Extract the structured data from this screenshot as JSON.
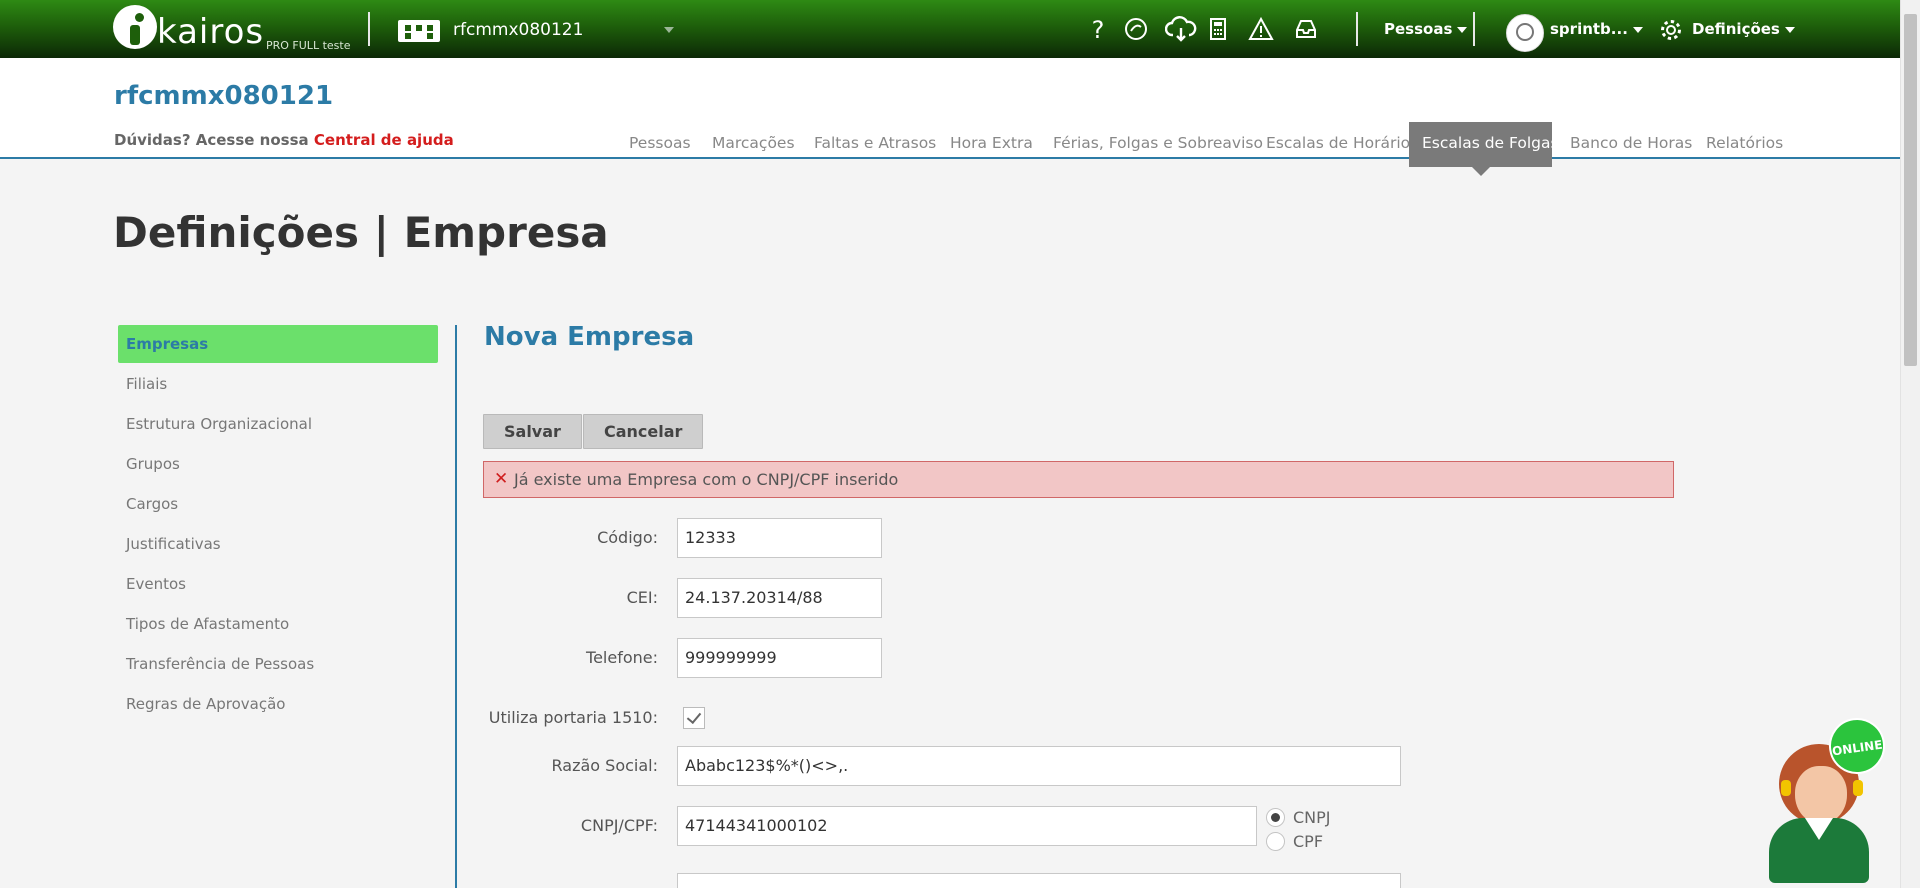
{
  "topbar": {
    "logo_word": "kairos",
    "logo_sub": "PRO FULL teste",
    "tenant_name": "rfcmmx080121",
    "menu_pessoas": "Pessoas",
    "user_name": "sprintb...",
    "menu_definicoes": "Definições",
    "icons": [
      "question-icon",
      "support-chat-icon",
      "cloud-download-icon",
      "calculator-icon",
      "warning-icon",
      "inbox-icon",
      "gear-icon"
    ]
  },
  "header": {
    "site_title": "rfcmmx080121",
    "help_prefix": "Dúvidas? Acesse nossa",
    "help_link": "Central de ajuda"
  },
  "nav": [
    {
      "label": "Pessoas"
    },
    {
      "label": "Marcações"
    },
    {
      "label": "Faltas e Atrasos"
    },
    {
      "label": "Hora Extra"
    },
    {
      "label": "Férias, Folgas e Sobreaviso"
    },
    {
      "label": "Escalas de Horário"
    },
    {
      "label": "Escalas de Folgas",
      "active": true
    },
    {
      "label": "Banco de Horas"
    },
    {
      "label": "Relatórios"
    }
  ],
  "page_title": "Definições | Empresa",
  "sidebar": [
    {
      "label": "Empresas",
      "active": true
    },
    {
      "label": "Filiais"
    },
    {
      "label": "Estrutura Organizacional"
    },
    {
      "label": "Grupos"
    },
    {
      "label": "Cargos"
    },
    {
      "label": "Justificativas"
    },
    {
      "label": "Eventos"
    },
    {
      "label": "Tipos de Afastamento"
    },
    {
      "label": "Transferência de Pessoas"
    },
    {
      "label": "Regras de Aprovação"
    }
  ],
  "form": {
    "title": "Nova Empresa",
    "save_label": "Salvar",
    "cancel_label": "Cancelar",
    "error_message": "Já existe uma Empresa com o CNPJ/CPF inserido",
    "codigo_label": "Código:",
    "codigo_value": "12333",
    "cei_label": "CEI:",
    "cei_value": "24.137.20314/88",
    "telefone_label": "Telefone:",
    "telefone_value": "999999999",
    "portaria_label": "Utiliza portaria 1510:",
    "portaria_checked": true,
    "razao_label": "Razão Social:",
    "razao_value": "Ababc123$%*()<>,.",
    "cnpj_label": "CNPJ/CPF:",
    "cnpj_value": "47144341000102",
    "radio_cnpj": "CNPJ",
    "radio_cpf": "CPF",
    "radio_selected": "CNPJ"
  },
  "chat": {
    "badge": "ONLINE"
  },
  "colors": {
    "brand_green": "#1e5f0b",
    "accent_blue": "#2c7ba6",
    "active_sidebar": "#6be06b",
    "error_bg": "#f2c6c6",
    "help_red": "#d41d1d"
  }
}
